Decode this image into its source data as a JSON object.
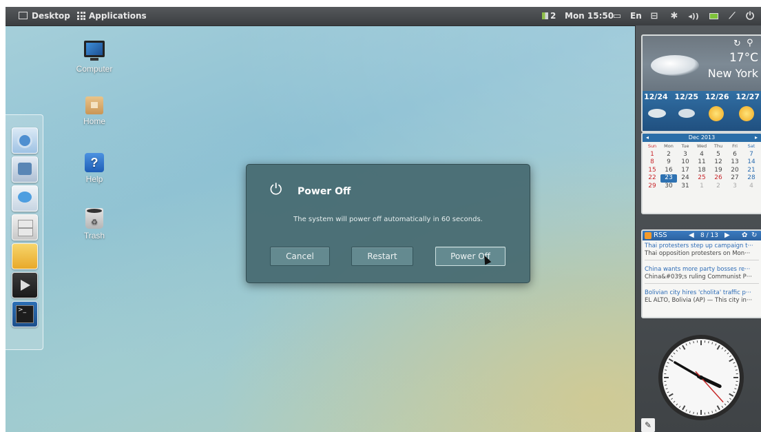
{
  "topbar": {
    "desktop_label": "Desktop",
    "applications_label": "Applications",
    "workspace_count": "2",
    "datetime": "Mon 15:50",
    "keyboard_layout": "En"
  },
  "desktop_icons": [
    {
      "label": "Computer",
      "icon": "computer-icon"
    },
    {
      "label": "Home",
      "icon": "home-folder-icon"
    },
    {
      "label": "Help",
      "icon": "help-icon"
    },
    {
      "label": "Trash",
      "icon": "trash-icon"
    }
  ],
  "dock": [
    {
      "name": "chromium-icon",
      "color": "#5aa3e0"
    },
    {
      "name": "mail-client-icon",
      "color": "#c9d6e6"
    },
    {
      "name": "chat-icon",
      "color": "#d8e6f2"
    },
    {
      "name": "file-cabinet-icon",
      "color": "#d8d8d8"
    },
    {
      "name": "cheese-icon",
      "color": "#f1c33a"
    },
    {
      "name": "video-player-icon",
      "color": "#2b2b2b"
    },
    {
      "name": "terminal-icon",
      "color": "#3a4a5a"
    }
  ],
  "dialog": {
    "title": "Power Off",
    "message": "The system will power off automatically in 60 seconds.",
    "cancel_label": "Cancel",
    "restart_label": "Restart",
    "poweroff_label": "Power Off"
  },
  "weather": {
    "temperature": "17°C",
    "city": "New York",
    "forecast_dates": [
      "12/24",
      "12/25",
      "12/26",
      "12/27"
    ],
    "forecast_icons": [
      "cloud-icon",
      "rain-icon",
      "partly-sunny-icon",
      "partly-sunny-icon"
    ]
  },
  "calendar": {
    "month_label": "Dec 2013",
    "weekdays": [
      "Sun",
      "Mon",
      "Tue",
      "Wed",
      "Thu",
      "Fri",
      "Sat"
    ],
    "weeks": [
      [
        "1",
        "2",
        "3",
        "4",
        "5",
        "6",
        "7"
      ],
      [
        "8",
        "9",
        "10",
        "11",
        "12",
        "13",
        "14"
      ],
      [
        "15",
        "16",
        "17",
        "18",
        "19",
        "20",
        "21"
      ],
      [
        "22",
        "23",
        "24",
        "25",
        "26",
        "27",
        "28"
      ],
      [
        "29",
        "30",
        "31",
        "1",
        "2",
        "3",
        "4"
      ]
    ],
    "today": "23",
    "holidays": [
      "25",
      "26"
    ]
  },
  "rss": {
    "label": "RSS",
    "position": "8 / 13",
    "items": [
      {
        "title": "Thai protesters step up campaign t···",
        "desc": "Thai opposition protesters on Mon···"
      },
      {
        "title": "China wants more party bosses re···",
        "desc": "China&#039;s ruling Communist P···"
      },
      {
        "title": "Bolivian city hires 'cholita' traffic p···",
        "desc": "EL ALTO, Bolivia (AP) — This city in···"
      }
    ]
  },
  "clock": {
    "hour": 3,
    "minute": 50,
    "second": 23
  }
}
